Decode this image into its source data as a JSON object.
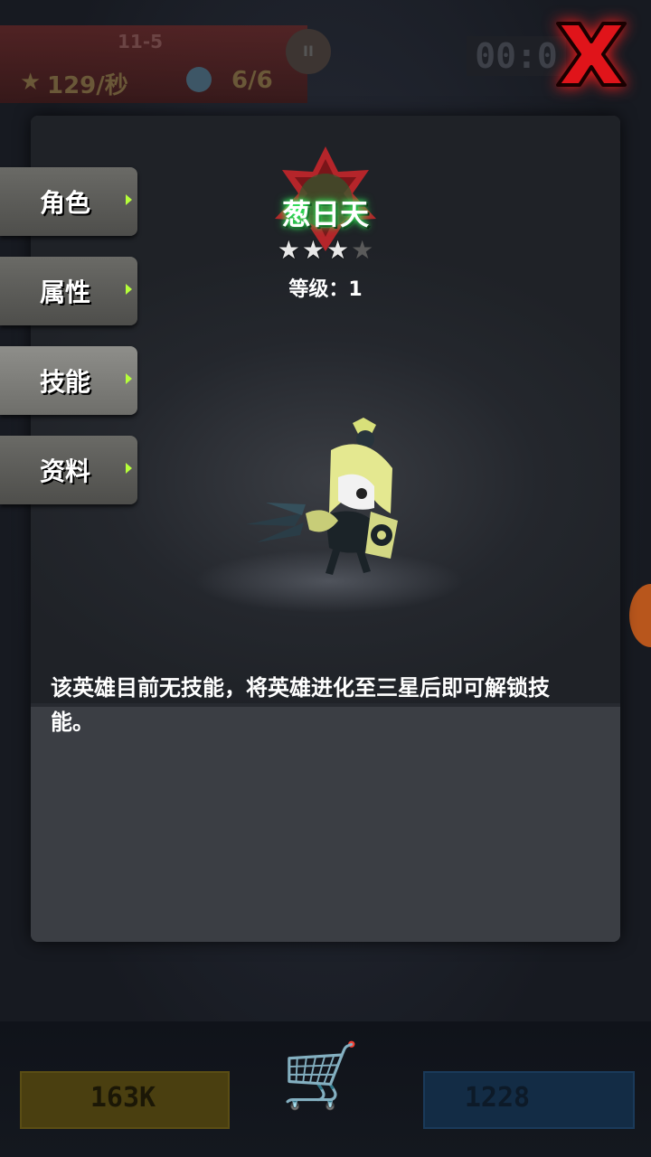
{
  "hud": {
    "stage": "11-5",
    "score_rate": "129/秒",
    "team": "6/6",
    "timer": "00:0"
  },
  "hero": {
    "name": "葱日天",
    "stars_filled": 3,
    "stars_total": 4,
    "level": "等级：1"
  },
  "tabs": [
    {
      "label": "角色"
    },
    {
      "label": "属性"
    },
    {
      "label": "技能"
    },
    {
      "label": "资料"
    }
  ],
  "active_tab": "技能",
  "skill_description": "该英雄目前无技能，将英雄进化至三星后即可解锁技能。",
  "currency": {
    "gold": "163K",
    "gems": "1228"
  },
  "colors": {
    "tab_arrow": "#b6ff3a",
    "name_glow": "#39ff66",
    "close_red": "#ff1a1a"
  }
}
